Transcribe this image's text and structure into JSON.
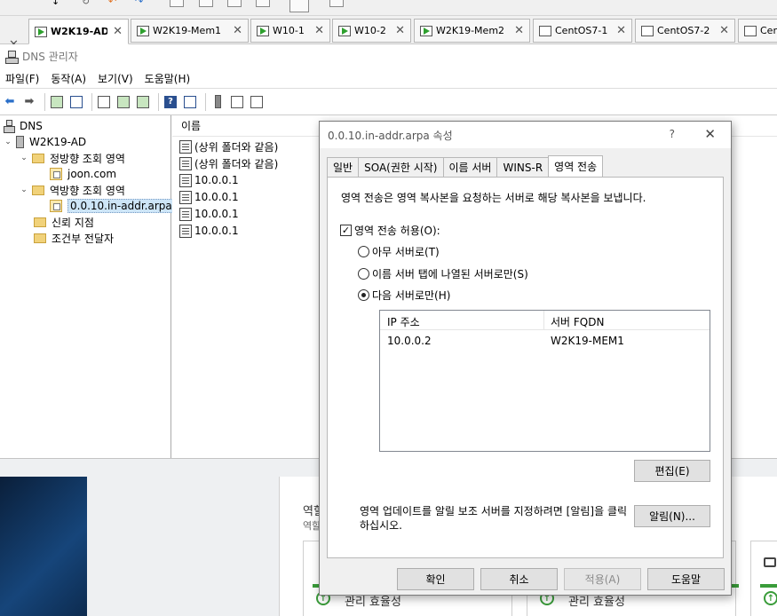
{
  "vm_tabs": [
    {
      "label": "W2K19-AD",
      "state": "running",
      "active": true
    },
    {
      "label": "W2K19-Mem1",
      "state": "running",
      "active": false
    },
    {
      "label": "W10-1",
      "state": "running",
      "active": false
    },
    {
      "label": "W10-2",
      "state": "running",
      "active": false
    },
    {
      "label": "W2K19-Mem2",
      "state": "running",
      "active": false
    },
    {
      "label": "CentOS7-1",
      "state": "off",
      "active": false
    },
    {
      "label": "CentOS7-2",
      "state": "off",
      "active": false
    },
    {
      "label": "Cent",
      "state": "off",
      "active": false
    }
  ],
  "close_glyph": "✕",
  "window": {
    "title": "DNS 관리자"
  },
  "menu": [
    "파일(F)",
    "동작(A)",
    "보기(V)",
    "도움말(H)"
  ],
  "tree": {
    "root": "DNS",
    "server": "W2K19-AD",
    "forward_zones": "정방향 조회 영역",
    "forward_child": "joon.com",
    "reverse_zones": "역방향 조회 영역",
    "reverse_child": "0.0.10.in-addr.arpa",
    "trust_points": "신뢰 지점",
    "conditional_forwarders": "조건부 전달자"
  },
  "list": {
    "header": "이름",
    "rows": [
      "(상위 폴더와 같음)",
      "(상위 폴더와 같음)",
      "10.0.0.1",
      "10.0.0.1",
      "10.0.0.1",
      "10.0.0.1"
    ]
  },
  "dialog": {
    "title": "0.0.10.in-addr.arpa 속성",
    "help_glyph": "?",
    "close_glyph": "✕",
    "tabs": [
      "일반",
      "SOA(권한 시작)",
      "이름 서버",
      "WINS-R",
      "영역 전송"
    ],
    "active_tab": 4,
    "description": "영역 전송은 영역 복사본을 요청하는 서버로 해당 복사본을 보냅니다.",
    "allow_transfer_label": "영역 전송 허용(O):",
    "allow_transfer_checked": true,
    "radio_any": "아무 서버로(T)",
    "radio_ns_tab": "이름 서버 탭에 나열된 서버로만(S)",
    "radio_following": "다음 서버로만(H)",
    "selected_radio": "following",
    "server_list": {
      "col_ip": "IP 주소",
      "col_fqdn": "서버 FQDN",
      "rows": [
        {
          "ip": "10.0.0.2",
          "fqdn": "W2K19-MEM1"
        }
      ]
    },
    "edit_button": "편집(E)",
    "notify_text": "영역 업데이트를 알릴 보조 서버를 지정하려면 [알림]을 클릭하십시오.",
    "notify_button": "알림(N)...",
    "ok_button": "확인",
    "cancel_button": "취소",
    "apply_button": "적용(A)",
    "help_button": "도움말"
  },
  "background": {
    "heading_partial": "역할",
    "sub_partial": "역할",
    "card_label_1": "관리 효율성",
    "card_label_2": "관리 효율성"
  }
}
